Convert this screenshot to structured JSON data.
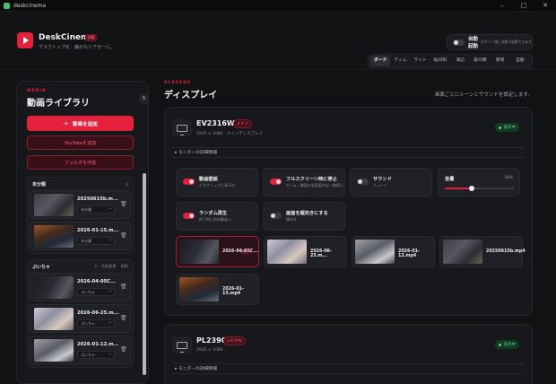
{
  "window": {
    "title": "deskcinema",
    "controls": [
      "–",
      "□",
      "✕"
    ]
  },
  "header": {
    "app_name": "DeskCinema",
    "badge": "β版",
    "tagline": "デスクトップを、静かなシアターに。",
    "autostart": {
      "label": "自動起動",
      "sub": "ログイン後に自動で起動できます",
      "on": false
    },
    "themes": [
      "ダーク",
      "ティム",
      "ライト",
      "桜日和",
      "海辺",
      "森の朝",
      "夢夜",
      "自動"
    ],
    "active_theme": "ダーク"
  },
  "sidebar": {
    "kicker": "MEDIA",
    "title": "動画ライブラリ",
    "count": "5",
    "add_button": "動画を追加",
    "youtube_button": "YouTubeを追加",
    "folder_button": "フォルダを作成",
    "groups": [
      {
        "name": "未分類",
        "count": "2",
        "items": [
          {
            "name": "20250615b.m...",
            "folder": "未分類"
          },
          {
            "name": "2026-01-15.m...",
            "folder": "未分類"
          }
        ]
      },
      {
        "name": "ぷいちゃ",
        "count": "3",
        "rename": "名前変更",
        "delete": "削除",
        "items": [
          {
            "name": "2026-04-05C...",
            "folder": "ぷいちゃ"
          },
          {
            "name": "2026-06-25.m...",
            "folder": "ぷいちゃ"
          },
          {
            "name": "2026-01-12.m...",
            "folder": "ぷいちゃ"
          }
        ]
      }
    ]
  },
  "main": {
    "kicker": "SCREENS",
    "title": "ディスプレイ",
    "hint": "画面ごとにシーンとサウンドを設定します。",
    "monitors": [
      {
        "name": "EV2316W",
        "badge": "メイン",
        "sub": "1920 × 1080 · メインディスプレイ",
        "status": "表示中",
        "details": "モニターの詳細情報",
        "options": [
          {
            "title": "動画壁紙",
            "sub": "デスクトップに表示中",
            "on": true
          },
          {
            "title": "フルスクリーン時に停止",
            "sub": "ゲーム・動画の全画面中は一時停止",
            "on": true
          },
          {
            "title": "サウンド",
            "sub": "ミュート",
            "on": false
          },
          {
            "title": "ランダム再生",
            "sub": "終了時に別の動画へ",
            "on": true
          },
          {
            "title": "画面を縦向きにする",
            "sub": "横向き",
            "on": false
          }
        ],
        "volume": {
          "label": "音量",
          "value": 38,
          "display": "38%"
        },
        "videos": [
          {
            "name": "2026-04-05C...",
            "playing": "再生中"
          },
          {
            "name": "2026-06-25.m..."
          },
          {
            "name": "2026-01-12.mp4"
          },
          {
            "name": "20250615b.mp4"
          },
          {
            "name": "2026-01-15.mp4"
          }
        ]
      },
      {
        "name": "PL2390",
        "badge": "いいやも",
        "sub": "1920 × 1080",
        "status": "表示中",
        "details": "モニターの詳細情報"
      }
    ]
  },
  "colors": {
    "accent": "#e5203d",
    "bg": "#111214",
    "panel": "#17181b",
    "status_green": "#5fd38a"
  }
}
